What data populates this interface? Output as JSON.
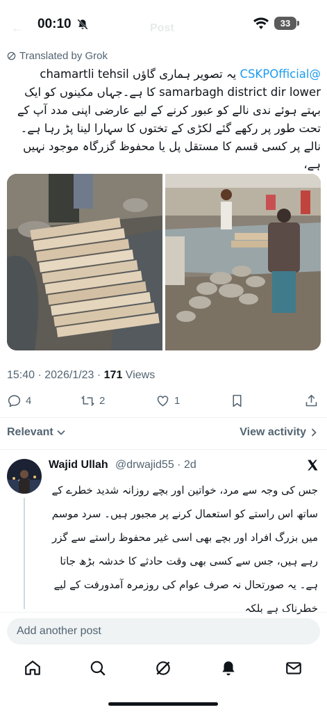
{
  "status_bar": {
    "time": "00:10",
    "battery": "33"
  },
  "header": {
    "back_glyph": "←",
    "title": "Post"
  },
  "translation": {
    "label": "Translated by Grok"
  },
  "post": {
    "mention": "@CSKPOfficial",
    "text_after_mention": " یہ تصویر ہماری گاؤں chamartli tehsil samarbagh district dir lower کا ہے۔جہاں مکینوں کو ایک بہتے ہوئے ندی نالے کو عبور کرنے کے لیے عارضی اپنی مدد آپ کے تحت طور پر رکھے گئے لکڑی کے تختوں کا سہارا لینا پڑ رہا ہے۔ نالے پر کسی قسم کا مستقل پل یا محفوظ گزرگاہ موجود نہیں ہے،",
    "timestamp": "15:40 · 2026/1/23 · ",
    "views_count": "171",
    "views_label": " Views"
  },
  "actions": {
    "replies": "4",
    "reposts": "2",
    "likes": "1"
  },
  "sort": {
    "relevant_label": "Relevant",
    "view_activity_label": "View activity"
  },
  "reply": {
    "name": "Wajid Ullah",
    "handle": "@drwajid55 · 2d",
    "text": "جس کی وجہ سے مرد، خواتین اور بچے روزانہ شدید خطرے کے ساتھ اس راستے کو استعمال کرنے پر مجبور ہیں۔ سرد موسم میں بزرگ افراد اور بچے بھی اسی غیر محفوظ راستے سے گزر رہے ہیں، جس سے کسی بھی وقت حادثے کا خدشہ بڑھ جاتا ہے۔ یہ صورتحال نہ صرف عوام کی روزمرہ آمدورفت کے لیے خطرناک ہے بلکہ"
  },
  "composer": {
    "placeholder": "Add another post"
  },
  "colors": {
    "accent": "#1d9bf0",
    "text": "#0f1419",
    "muted": "#536471"
  }
}
